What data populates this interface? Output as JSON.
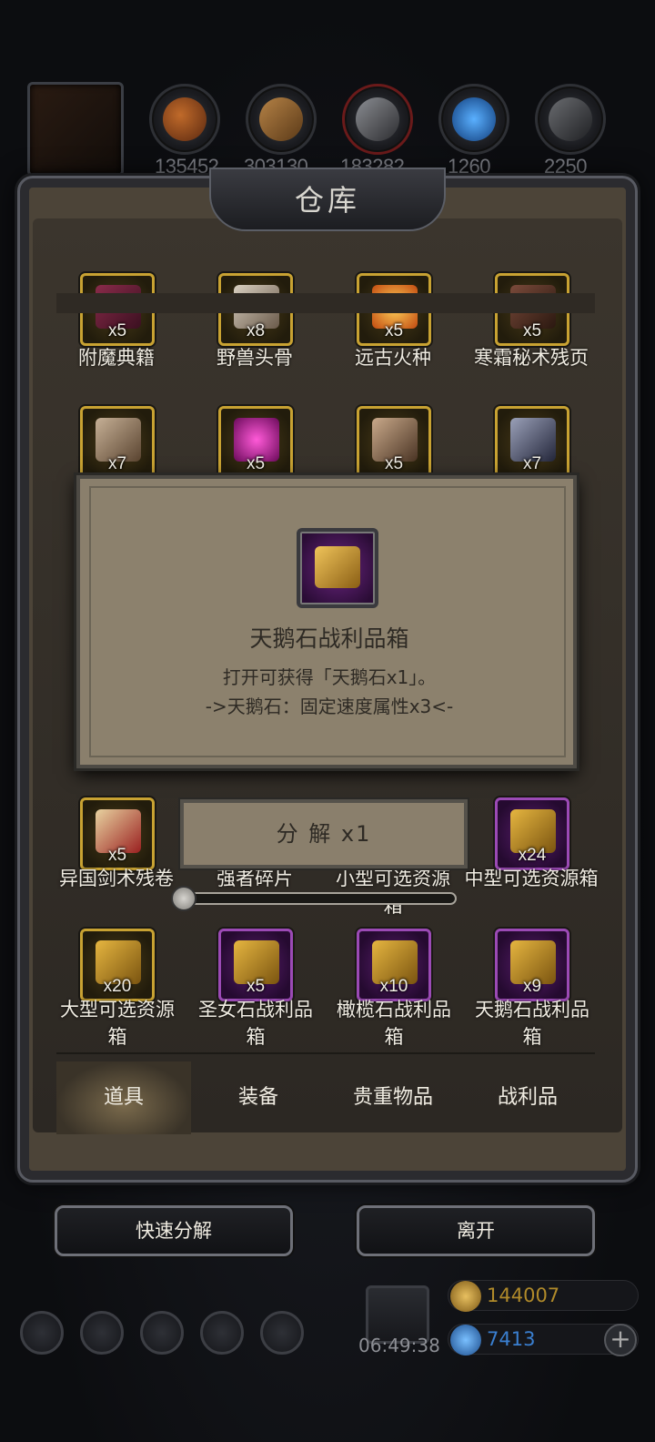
{
  "top_resources": [
    {
      "icon": "food-icon",
      "value": "135452"
    },
    {
      "icon": "wood-icon",
      "value": "303130"
    },
    {
      "icon": "iron-icon",
      "value": "183282"
    },
    {
      "icon": "crystal-icon",
      "value": "1260"
    },
    {
      "icon": "steel-icon",
      "value": "2250"
    }
  ],
  "window": {
    "title": "仓库"
  },
  "items": [
    {
      "name": "附魔典籍",
      "count": "x5",
      "rarity": "gold",
      "icon": "book-icon"
    },
    {
      "name": "野兽头骨",
      "count": "x8",
      "rarity": "gold",
      "icon": "skull-icon"
    },
    {
      "name": "远古火种",
      "count": "x5",
      "rarity": "gold",
      "icon": "flame-icon"
    },
    {
      "name": "寒霜秘术残页",
      "count": "x5",
      "rarity": "gold",
      "icon": "page-icon"
    },
    {
      "name": "",
      "count": "x7",
      "rarity": "gold",
      "icon": "claw-icon"
    },
    {
      "name": "",
      "count": "x5",
      "rarity": "gold",
      "icon": "pink-drop-icon"
    },
    {
      "name": "",
      "count": "x5",
      "rarity": "gold",
      "icon": "doll-icon"
    },
    {
      "name": "",
      "count": "x7",
      "rarity": "gold",
      "icon": "ore-icon"
    },
    {
      "name": "异国剑术残卷",
      "count": "x5",
      "rarity": "gold",
      "icon": "scroll-icon"
    },
    {
      "name": "强者碎片",
      "count": "",
      "rarity": "none",
      "icon": ""
    },
    {
      "name": "小型可选资源箱",
      "count": "",
      "rarity": "none",
      "icon": ""
    },
    {
      "name": "中型可选资源箱",
      "count": "x24",
      "rarity": "purple",
      "icon": "chest-icon"
    },
    {
      "name": "大型可选资源箱",
      "count": "x20",
      "rarity": "gold",
      "icon": "chest-icon"
    },
    {
      "name": "圣女石战利品箱",
      "count": "x5",
      "rarity": "purple",
      "icon": "chest-icon"
    },
    {
      "name": "橄榄石战利品箱",
      "count": "x10",
      "rarity": "purple",
      "icon": "chest-icon"
    },
    {
      "name": "天鹅石战利品箱",
      "count": "x9",
      "rarity": "purple",
      "icon": "chest-icon"
    }
  ],
  "partial_label_right": "籍",
  "popup": {
    "icon": "chest-icon",
    "title": "天鹅石战利品箱",
    "desc_line1": "打开可获得「天鹅石x1」。",
    "desc_line2": "->天鹅石：固定速度属性x3<-"
  },
  "decompose": {
    "label": "分 解 x1",
    "quantity": 1
  },
  "tabs": [
    {
      "label": "道具",
      "active": true
    },
    {
      "label": "装备",
      "active": false
    },
    {
      "label": "贵重物品",
      "active": false
    },
    {
      "label": "战利品",
      "active": false
    }
  ],
  "buttons": {
    "quick_decompose": "快速分解",
    "leave": "离开"
  },
  "hud": {
    "timer": "06:49:38",
    "gold": "144007",
    "gems": "7413",
    "plus": "+",
    "gold_color": "#b08a2a",
    "gem_color": "#3a7fd0"
  }
}
